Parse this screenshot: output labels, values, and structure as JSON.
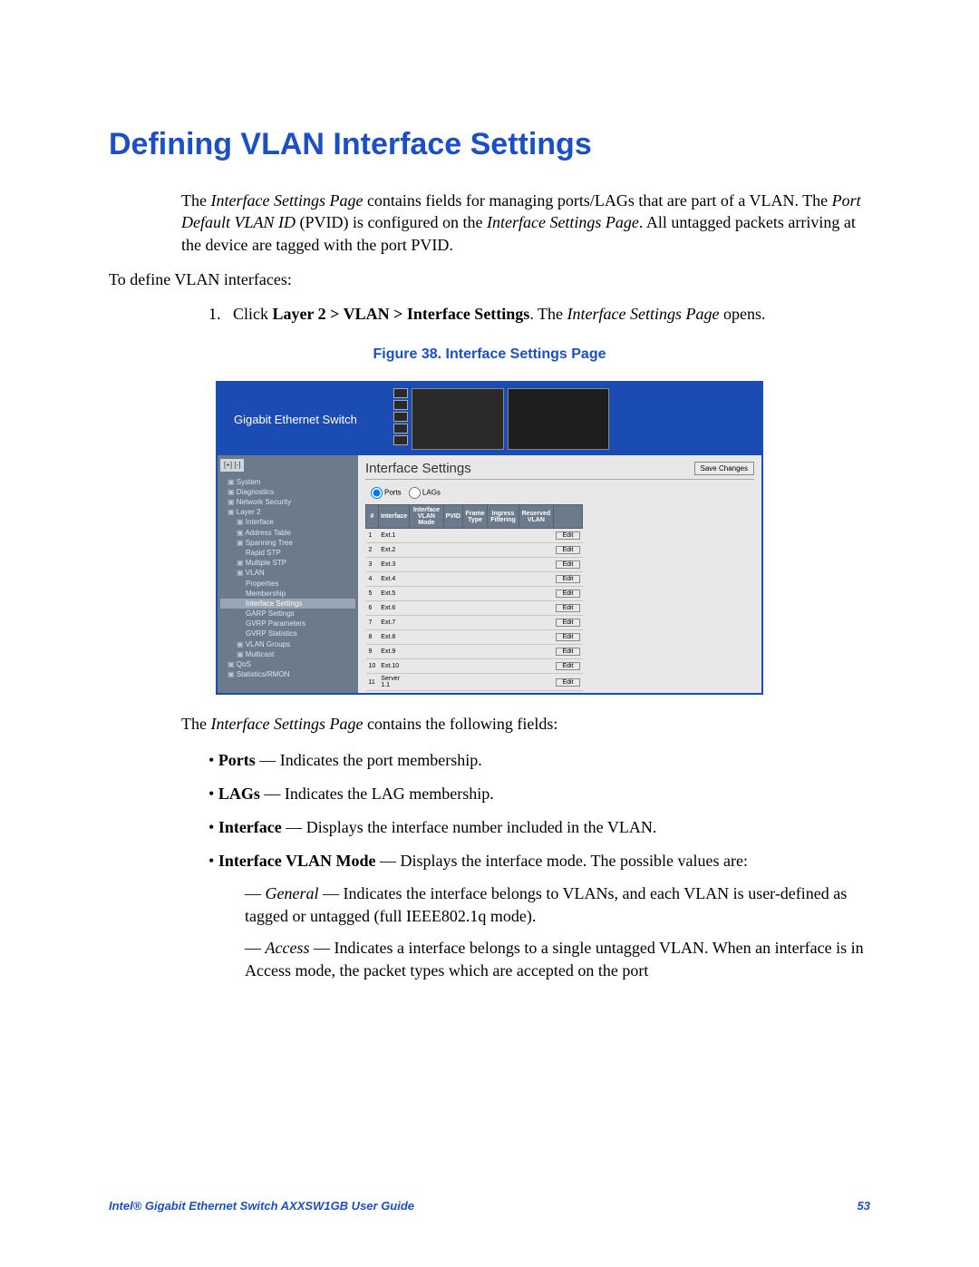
{
  "heading": "Defining VLAN Interface Settings",
  "intro": {
    "p1_pre": "The ",
    "p1_em1": "Interface Settings Page",
    "p1_mid": " contains fields for managing ports/LAGs that are part of a VLAN. The ",
    "p1_em2": "Port Default VLAN ID",
    "p1_mid2": " (PVID) is configured on the ",
    "p1_em3": "Interface Settings Page",
    "p1_post": ". All untagged packets arriving at the device are tagged with the port PVID.",
    "p2": "To define VLAN interfaces:"
  },
  "step1": {
    "num": "1.",
    "pre": "Click ",
    "bold": "Layer 2 > VLAN > Interface Settings",
    "mid": ". The ",
    "em": "Interface Settings Page",
    "post": " opens."
  },
  "figure_caption": "Figure 38. Interface Settings Page",
  "screenshot": {
    "brand": "Gigabit Ethernet Switch",
    "tree_tools": "[+] [-]",
    "tree": [
      {
        "t": "System",
        "l": 0
      },
      {
        "t": "Diagnostics",
        "l": 0
      },
      {
        "t": "Network Security",
        "l": 0
      },
      {
        "t": "Layer 2",
        "l": 0
      },
      {
        "t": "Interface",
        "l": 1
      },
      {
        "t": "Address Table",
        "l": 1
      },
      {
        "t": "Spanning Tree",
        "l": 1
      },
      {
        "t": "Rapid STP",
        "l": 2
      },
      {
        "t": "Multiple STP",
        "l": 1
      },
      {
        "t": "VLAN",
        "l": 1
      },
      {
        "t": "Properties",
        "l": 2
      },
      {
        "t": "Membership",
        "l": 2
      },
      {
        "t": "Interface Settings",
        "l": 2,
        "sel": true
      },
      {
        "t": "GARP Settings",
        "l": 2
      },
      {
        "t": "GVRP Parameters",
        "l": 2
      },
      {
        "t": "GVRP Statistics",
        "l": 2
      },
      {
        "t": "VLAN Groups",
        "l": 1
      },
      {
        "t": "Multicast",
        "l": 1
      },
      {
        "t": "QoS",
        "l": 0
      },
      {
        "t": "Statistics/RMON",
        "l": 0
      }
    ],
    "main_title": "Interface Settings",
    "save_label": "Save Changes",
    "radio_ports": "Ports",
    "radio_lags": "LAGs",
    "cols": [
      "#",
      "Interface",
      "Interface VLAN Mode",
      "PVID",
      "Frame Type",
      "Ingress Filtering",
      "Reserved VLAN"
    ],
    "rows": [
      {
        "n": "1",
        "if": "Ext.1"
      },
      {
        "n": "2",
        "if": "Ext.2"
      },
      {
        "n": "3",
        "if": "Ext.3"
      },
      {
        "n": "4",
        "if": "Ext.4"
      },
      {
        "n": "5",
        "if": "Ext.5"
      },
      {
        "n": "6",
        "if": "Ext.6"
      },
      {
        "n": "7",
        "if": "Ext.7"
      },
      {
        "n": "8",
        "if": "Ext.8"
      },
      {
        "n": "9",
        "if": "Ext.9"
      },
      {
        "n": "10",
        "if": "Ext.10"
      },
      {
        "n": "11",
        "if": "Server 1.1"
      }
    ],
    "edit_label": "Edit"
  },
  "after": {
    "lead_pre": "The ",
    "lead_em": "Interface Settings Page",
    "lead_post": " contains the following fields:",
    "b_ports_b": "Ports",
    "b_ports_t": " — Indicates the port membership.",
    "b_lags_b": "LAGs",
    "b_lags_t": " — Indicates the LAG membership.",
    "b_if_b": "Interface",
    "b_if_t": " — Displays the interface number included in the VLAN.",
    "b_mode_b": "Interface VLAN Mode",
    "b_mode_t": " — Displays the interface mode. The possible values are:",
    "sub_general_em": "General",
    "sub_general_t": " — Indicates the interface belongs to VLANs, and each VLAN is user-defined as tagged or untagged (full IEEE802.1q mode).",
    "sub_access_em": "Access",
    "sub_access_t": " — Indicates a interface belongs to a single untagged VLAN. When an interface is in Access mode, the packet types which are accepted on the port"
  },
  "footer_left": "Intel® Gigabit Ethernet Switch AXXSW1GB User Guide",
  "footer_right": "53"
}
